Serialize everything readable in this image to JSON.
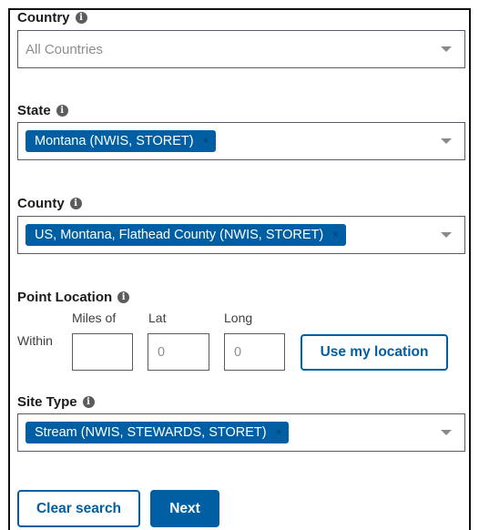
{
  "country": {
    "label": "Country",
    "info_icon": "i",
    "placeholder": "All Countries"
  },
  "state": {
    "label": "State",
    "info_icon": "i",
    "chip": "Montana (NWIS, STORET)",
    "chip_remove": "×"
  },
  "county": {
    "label": "County",
    "info_icon": "i",
    "chip": "US, Montana, Flathead County (NWIS, STORET)",
    "chip_remove": "×"
  },
  "point_location": {
    "label": "Point Location",
    "info_icon": "i",
    "within_label": "Within",
    "miles_label": "Miles of",
    "miles_value": "",
    "lat_label": "Lat",
    "lat_value": "0",
    "long_label": "Long",
    "long_value": "0",
    "use_location_button": "Use my location"
  },
  "site_type": {
    "label": "Site Type",
    "info_icon": "i",
    "chip": "Stream (NWIS, STEWARDS, STORET)",
    "chip_remove": "×"
  },
  "actions": {
    "clear_button": "Clear search",
    "next_button": "Next"
  },
  "colors": {
    "primary": "#005ea2",
    "border": "#565c65",
    "placeholder": "#8d8d8d"
  }
}
